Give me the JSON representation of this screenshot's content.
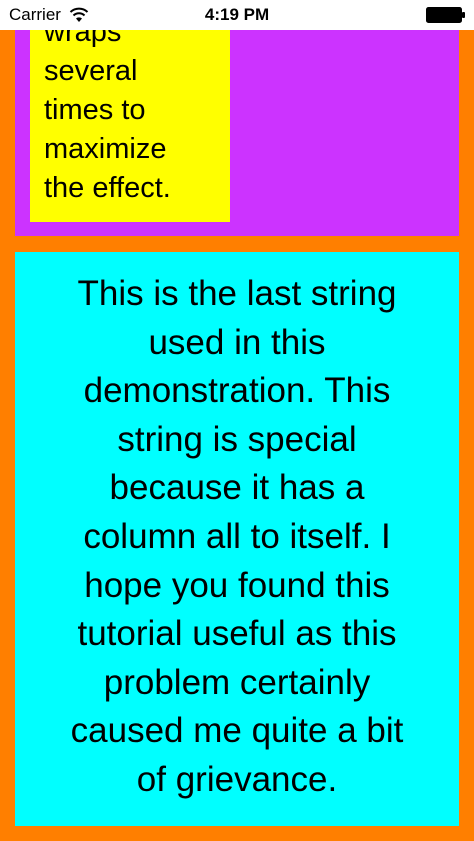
{
  "status_bar": {
    "carrier": "Carrier",
    "time": "4:19 PM",
    "wifi_icon": "wifi-icon",
    "battery_icon": "battery-icon"
  },
  "top_cell": {
    "background": "#cc33ff",
    "label_background": "#ffff00",
    "text": "wraps\nseveral\ntimes to\nmaximize\nthe effect."
  },
  "bottom_cell": {
    "background": "#00ffff",
    "text": "This is the last string\nused in this\ndemonstration. This\nstring is special\nbecause it has a\ncolumn all to itself. I\nhope you found this\ntutorial useful as this\nproblem certainly\ncaused me quite a bit\nof grievance."
  },
  "colors": {
    "frame": "#ff7f00"
  }
}
